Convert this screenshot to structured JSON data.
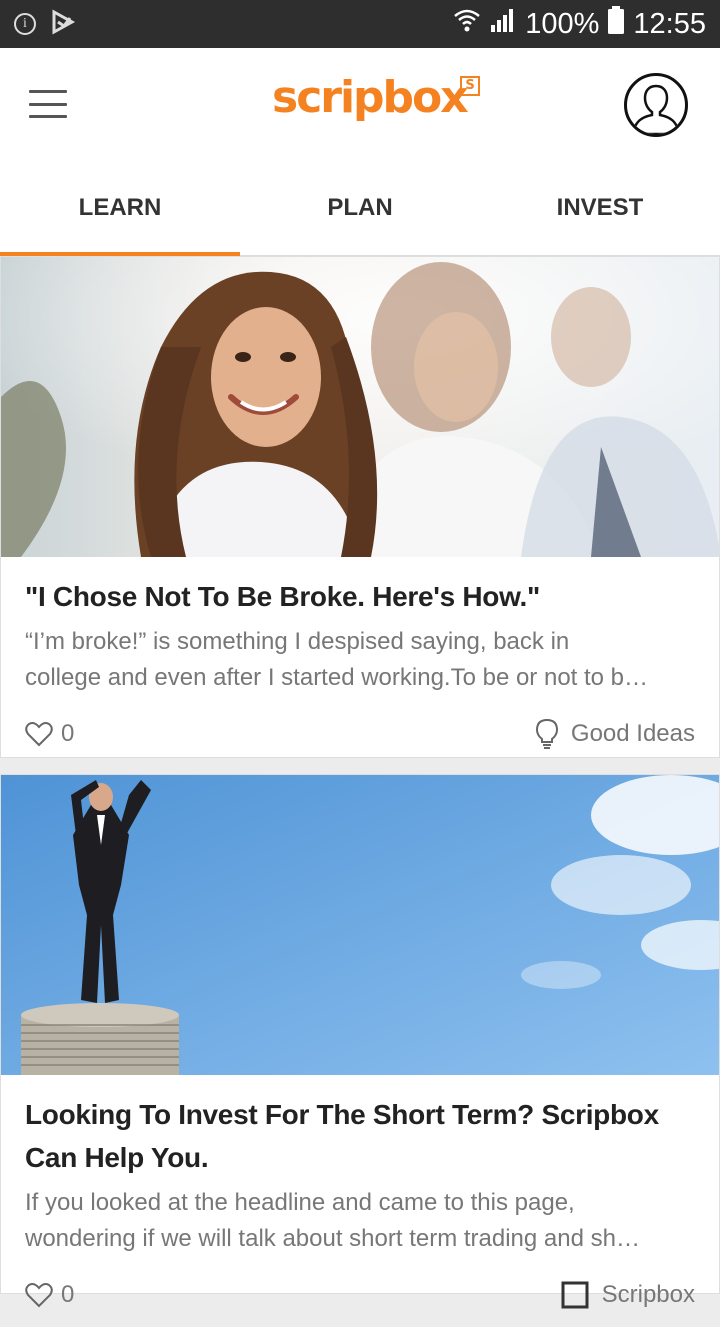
{
  "status_bar": {
    "battery": "100%",
    "time": "12:55"
  },
  "app": {
    "logo_text": "scripbox",
    "logo_mark": "S",
    "brand_color": "#f58220"
  },
  "tabs": [
    {
      "label": "LEARN",
      "active": true
    },
    {
      "label": "PLAN",
      "active": false
    },
    {
      "label": "INVEST",
      "active": false
    }
  ],
  "articles": [
    {
      "title": "\"I Chose Not To Be Broke. Here's How.\"",
      "excerpt_line1": "“I’m broke!” is something I despised saying, back in",
      "excerpt_line2": "college and even after I started working.To be or not to b…",
      "likes": "0",
      "category": "Good Ideas",
      "category_icon": "lightbulb-icon"
    },
    {
      "title_line1": "Looking To Invest For The Short Term? Scripbox",
      "title_line2": "Can Help You.",
      "excerpt_line1": "If you looked at the headline and came to this page,",
      "excerpt_line2": "wondering if we will talk about short term trading and sh…",
      "likes": "0",
      "category": "Scripbox",
      "category_icon": "scripbox-icon"
    }
  ]
}
